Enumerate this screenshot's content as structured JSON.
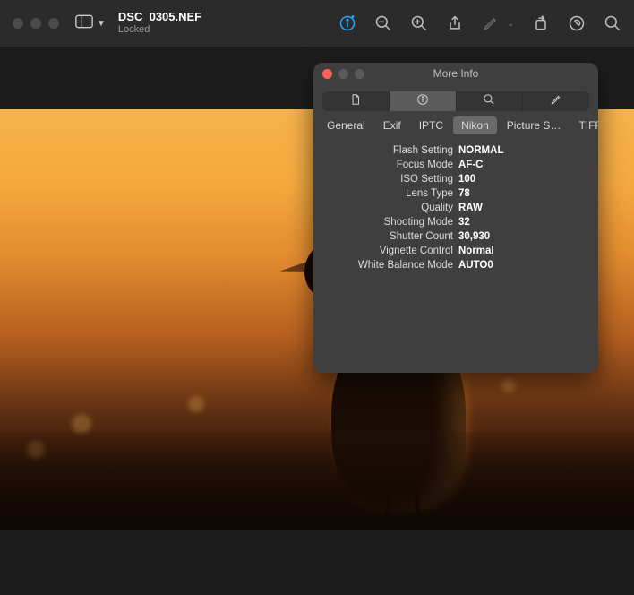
{
  "header": {
    "filename": "DSC_0305.NEF",
    "subtitle": "Locked"
  },
  "panel": {
    "title": "More Info",
    "tabs": {
      "general": "General",
      "exif": "Exif",
      "iptc": "IPTC",
      "nikon": "Nikon",
      "picture": "Picture S…",
      "tiff": "TIFF"
    },
    "rows": {
      "flash_setting": {
        "label": "Flash Setting",
        "value": "NORMAL"
      },
      "focus_mode": {
        "label": "Focus Mode",
        "value": "AF-C"
      },
      "iso_setting": {
        "label": "ISO Setting",
        "value": "100"
      },
      "lens_type": {
        "label": "Lens Type",
        "value": "78"
      },
      "quality": {
        "label": "Quality",
        "value": "RAW"
      },
      "shooting_mode": {
        "label": "Shooting Mode",
        "value": "32"
      },
      "shutter_count": {
        "label": "Shutter Count",
        "value": "30,930"
      },
      "vignette_control": {
        "label": "Vignette Control",
        "value": "Normal"
      },
      "white_balance_mode": {
        "label": "White Balance Mode",
        "value": "AUTO0"
      }
    }
  }
}
